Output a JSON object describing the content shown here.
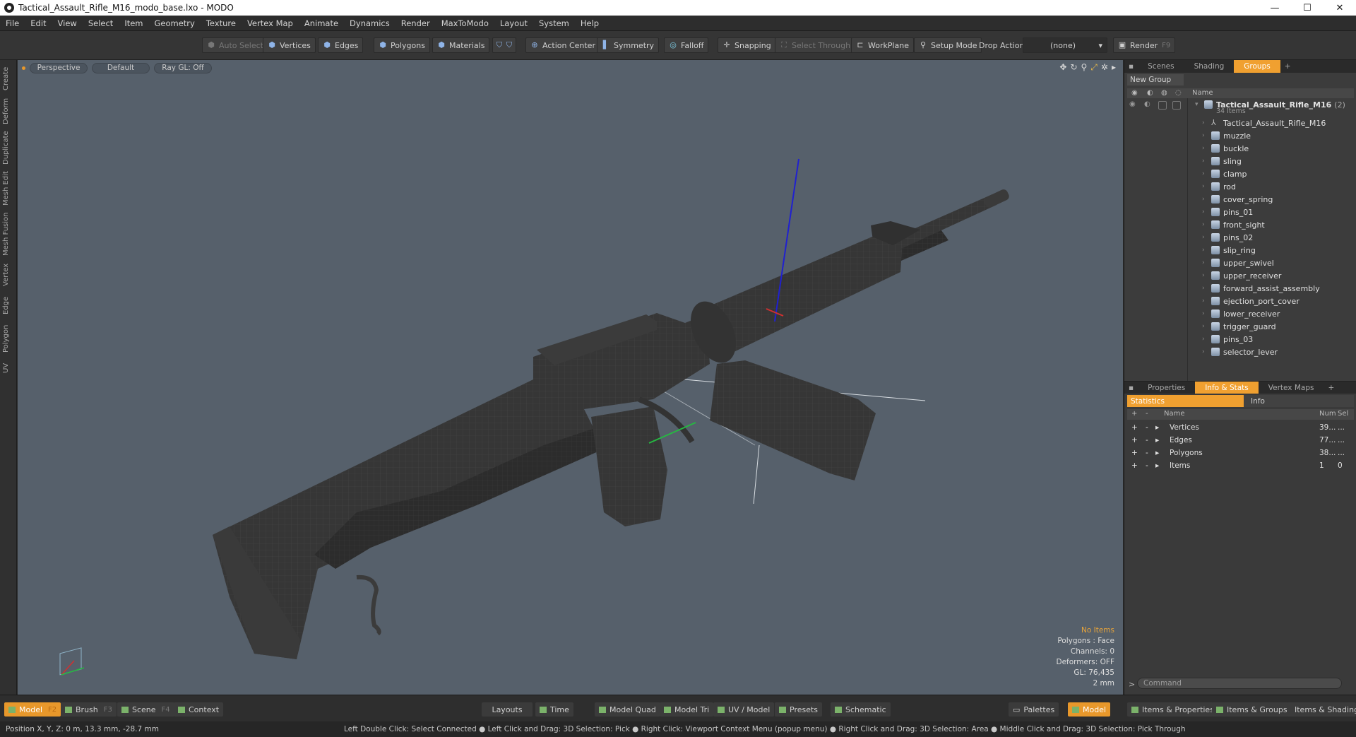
{
  "window": {
    "title": "Tactical_Assault_Rifle_M16_modo_base.lxo - MODO",
    "minimize": "—",
    "maximize": "☐",
    "close": "✕"
  },
  "menu": [
    "File",
    "Edit",
    "View",
    "Select",
    "Item",
    "Geometry",
    "Texture",
    "Vertex Map",
    "Animate",
    "Dynamics",
    "Render",
    "MaxToModo",
    "Layout",
    "System",
    "Help"
  ],
  "toolbar": {
    "auto_select": "Auto Select",
    "vertices": "Vertices",
    "edges": "Edges",
    "polygons": "Polygons",
    "materials": "Materials",
    "action_center": "Action Center",
    "symmetry": "Symmetry",
    "falloff": "Falloff",
    "snapping": "Snapping",
    "select_through": "Select Through",
    "workplane": "WorkPlane",
    "setup_mode": "Setup Mode",
    "drop_action_label": "Drop Action",
    "drop_action_value": "(none)",
    "render": "Render",
    "render_key": "F9"
  },
  "left_tabs": [
    "Create",
    "Deform",
    "Duplicate",
    "Mesh Edit",
    "Mesh Fusion",
    "Vertex",
    "Edge",
    "Polygon",
    "UV"
  ],
  "viewport": {
    "view": "Perspective",
    "shading": "Default",
    "raygl": "Ray GL: Off",
    "stats": {
      "no_items": "No Items",
      "polygons": "Polygons : Face",
      "channels": "Channels: 0",
      "deformers": "Deformers: OFF",
      "gl": "GL: 76,435",
      "scale": "2 mm"
    }
  },
  "groups_panel": {
    "tabs": [
      "Scenes",
      "Shading",
      "Groups",
      "+"
    ],
    "active_tab": "Groups",
    "new_group": "New Group",
    "name_col": "Name",
    "root": {
      "label": "Tactical_Assault_Rifle_M16",
      "count": "(2)",
      "sub": "34 Items"
    },
    "items": [
      "Tactical_Assault_Rifle_M16",
      "muzzle",
      "buckle",
      "sling",
      "clamp",
      "rod",
      "cover_spring",
      "pins_01",
      "front_sight",
      "pins_02",
      "slip_ring",
      "upper_swivel",
      "upper_receiver",
      "forward_assist_assembly",
      "ejection_port_cover",
      "lower_receiver",
      "trigger_guard",
      "pins_03",
      "selector_lever"
    ]
  },
  "props_panel": {
    "tabs": [
      "Properties",
      "Info & Stats",
      "Vertex Maps",
      "+"
    ],
    "active_tab": "Info & Stats",
    "sub_tabs": [
      "Statistics",
      "Info"
    ],
    "cols": {
      "name": "Name",
      "num": "Num",
      "sel": "Sel"
    },
    "rows": [
      {
        "name": "Vertices",
        "num": "39...",
        "sel": "..."
      },
      {
        "name": "Edges",
        "num": "77...",
        "sel": "..."
      },
      {
        "name": "Polygons",
        "num": "38...",
        "sel": "..."
      },
      {
        "name": "Items",
        "num": "1",
        "sel": "0"
      }
    ],
    "command_placeholder": "Command",
    "command_prompt": ">"
  },
  "bottombar": {
    "model": "Model",
    "model_key": "F2",
    "brush": "Brush",
    "brush_key": "F3",
    "scene": "Scene",
    "scene_key": "F4",
    "context": "Context",
    "layouts": "Layouts",
    "time": "Time",
    "model_quad": "Model Quad",
    "model_tri": "Model Tri",
    "uv_model": "UV / Model",
    "presets": "Presets",
    "schematic": "Schematic",
    "palettes": "Palettes",
    "model2": "Model",
    "items_props": "Items & Properties",
    "items_groups": "Items & Groups",
    "items_shading": "Items & Shading"
  },
  "statusbar": {
    "position": "Position X, Y, Z:   0 m, 13.3 mm, -28.7 mm",
    "hint": "Left Double Click: Select Connected ● Left Click and Drag: 3D Selection: Pick ● Right Click: Viewport Context Menu (popup menu) ● Right Click and Drag: 3D Selection: Area ● Middle Click and Drag: 3D Selection: Pick Through"
  }
}
